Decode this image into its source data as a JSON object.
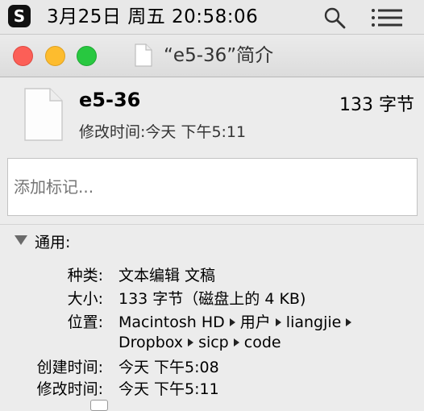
{
  "menubar": {
    "app_badge": "S",
    "clock": "3月25日 周五  20:58:06",
    "icons": [
      "search-icon",
      "menu-list-icon"
    ]
  },
  "window": {
    "title": "“e5-36”简介",
    "traffic_lights": {
      "close": "#fc5f57",
      "minimize": "#fdbc2e",
      "maximize": "#28c840"
    }
  },
  "header": {
    "file_name": "e5-36",
    "file_size": "133 字节",
    "modified_label": "修改时间:",
    "modified_value": "今天 下午5:11"
  },
  "tags": {
    "placeholder": "添加标记..."
  },
  "general": {
    "title": "通用:",
    "kind_label": "种类:",
    "kind_value": "文本编辑 文稿",
    "size_label": "大小:",
    "size_value": "133 字节（磁盘上的 4 KB)",
    "where_label": "位置:",
    "where_path": [
      "Macintosh HD",
      "用户",
      "liangjie",
      "Dropbox",
      "sicp",
      "code"
    ],
    "created_label": "创建时间:",
    "created_value": "今天 下午5:08",
    "modified_label": "修改时间:",
    "modified_value": "今天 下午5:11"
  }
}
